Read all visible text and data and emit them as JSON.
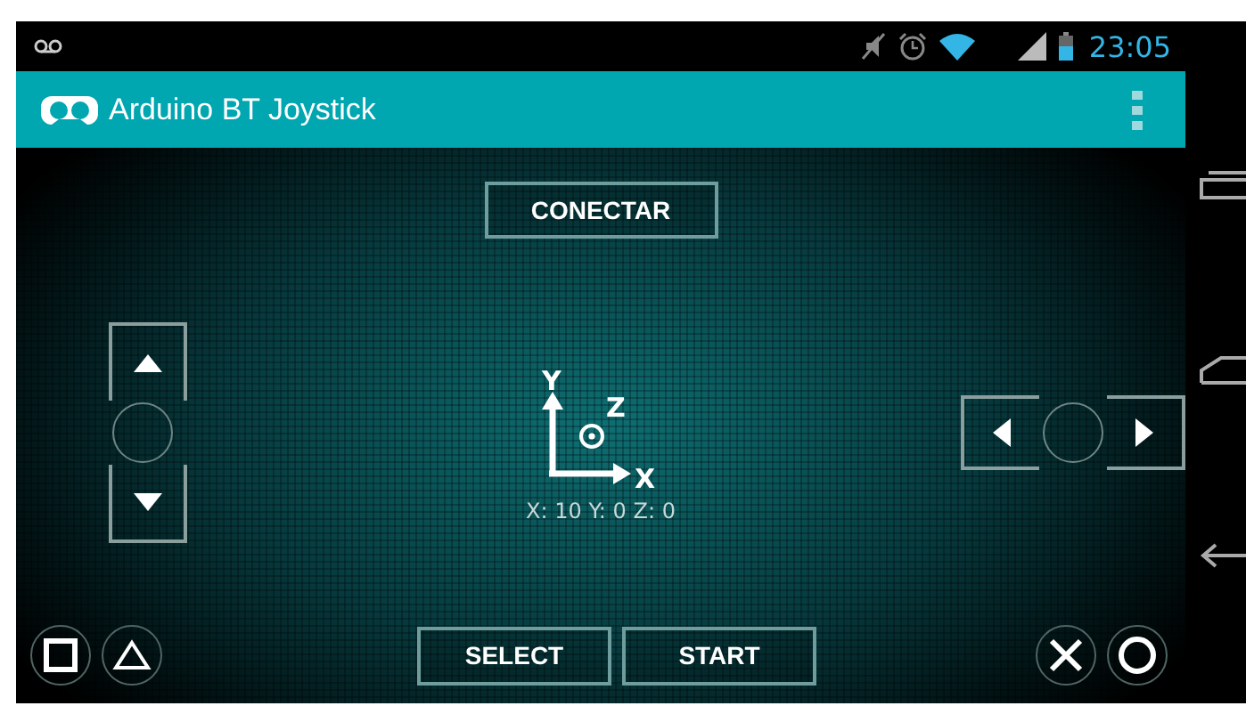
{
  "status_bar": {
    "time": "23:05"
  },
  "app_bar": {
    "title": "Arduino BT Joystick"
  },
  "connect_button": {
    "label": "CONECTAR"
  },
  "axes": {
    "y_label": "Y",
    "z_label": "Z",
    "x_label": "X",
    "reading": "X: 10 Y: 0 Z: 0"
  },
  "bottom_buttons": [
    {
      "label": "SELECT"
    },
    {
      "label": "START"
    }
  ]
}
